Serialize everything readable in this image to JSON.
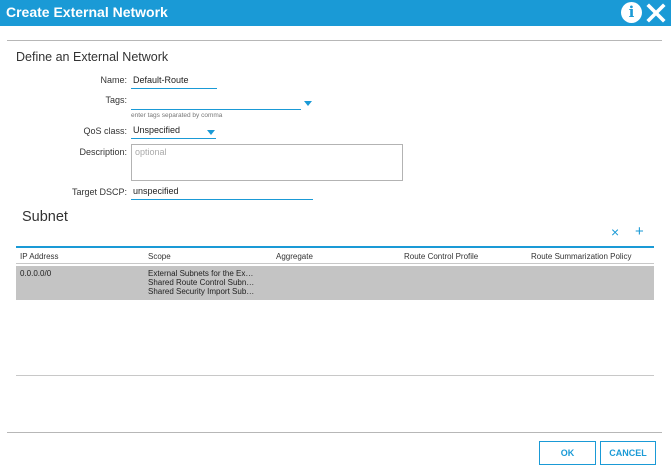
{
  "window": {
    "title": "Create External Network"
  },
  "form": {
    "section_title": "Define an External Network",
    "name": {
      "label": "Name:",
      "value": "Default-Route"
    },
    "tags": {
      "label": "Tags:",
      "value": "",
      "hint": "enter tags separated by comma"
    },
    "qos": {
      "label": "QoS class:",
      "value": "Unspecified"
    },
    "description": {
      "label": "Description:",
      "placeholder": "optional"
    },
    "dscp": {
      "label": "Target DSCP:",
      "value": "unspecified"
    }
  },
  "subnet": {
    "title": "Subnet",
    "tools": {
      "delete": "×",
      "add": "+"
    },
    "columns": [
      "IP Address",
      "Scope",
      "Aggregate",
      "Route Control Profile",
      "Route Summarization Policy"
    ],
    "rows": [
      {
        "ip": "0.0.0.0/0",
        "scope": [
          "External Subnets for the Ex…",
          "Shared Route Control Subn…",
          "Shared Security Import Sub…"
        ],
        "aggregate": "",
        "route_control_profile": "",
        "route_summarization_policy": ""
      }
    ]
  },
  "buttons": {
    "ok": "OK",
    "cancel": "CANCEL"
  },
  "colors": {
    "accent": "#1a9ad6",
    "selected_row": "#c4c4c4"
  },
  "icons": {
    "info": "info-icon",
    "close": "close-icon",
    "dropdown": "chevron-down-icon"
  }
}
